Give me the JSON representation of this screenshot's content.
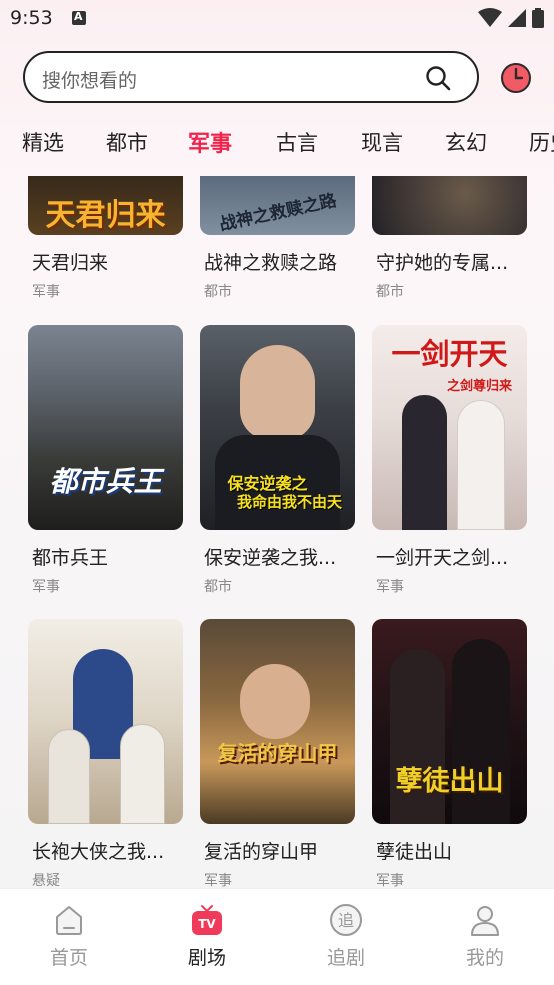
{
  "status_bar": {
    "time": "9:53"
  },
  "search": {
    "placeholder": "搜你想看的"
  },
  "tabs": [
    {
      "label": "精选",
      "active": false
    },
    {
      "label": "都市",
      "active": false
    },
    {
      "label": "军事",
      "active": true
    },
    {
      "label": "古言",
      "active": false
    },
    {
      "label": "现言",
      "active": false
    },
    {
      "label": "玄幻",
      "active": false
    },
    {
      "label": "历史",
      "active": false
    }
  ],
  "dramas": [
    {
      "title": "天君归来",
      "tag": "军事",
      "poster_text": "天君归来"
    },
    {
      "title": "战神之救赎之路",
      "tag": "都市",
      "poster_text": "战神之救赎之路"
    },
    {
      "title": "守护她的专属...",
      "tag": "都市",
      "poster_text": ""
    },
    {
      "title": "都市兵王",
      "tag": "军事",
      "poster_text": "都市兵王"
    },
    {
      "title": "保安逆袭之我...",
      "tag": "都市",
      "poster_text": "保安逆袭之",
      "poster_text2": "我命由我不由天"
    },
    {
      "title": "一剑开天之剑...",
      "tag": "军事",
      "poster_text": "一剑开天",
      "poster_text2": "之剑尊归来"
    },
    {
      "title": "长袍大侠之我...",
      "tag": "悬疑",
      "poster_text": ""
    },
    {
      "title": "复活的穿山甲",
      "tag": "军事",
      "poster_text": "复活的穿山甲"
    },
    {
      "title": "孽徒出山",
      "tag": "军事",
      "poster_text": "孽徒出山"
    }
  ],
  "bottom_nav": [
    {
      "label": "首页",
      "icon": "home-icon",
      "active": false
    },
    {
      "label": "剧场",
      "icon": "tv-icon",
      "active": true
    },
    {
      "label": "追剧",
      "icon": "follow-icon",
      "active": false
    },
    {
      "label": "我的",
      "icon": "user-icon",
      "active": false
    }
  ],
  "colors": {
    "accent": "#f0234d",
    "tv_badge": "#f03a5a"
  }
}
